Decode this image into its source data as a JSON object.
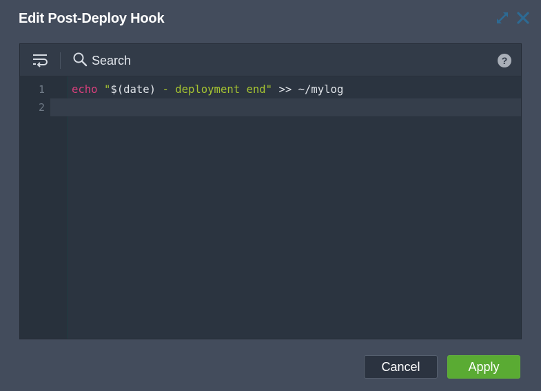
{
  "dialog": {
    "title": "Edit Post-Deploy Hook"
  },
  "header_icons": {
    "expand": "expand-arrows-icon",
    "close": "close-x-icon"
  },
  "toolbar": {
    "wrap_icon": "word-wrap-icon",
    "search_icon": "magnifier-icon",
    "search_label": "Search",
    "help_label": "?"
  },
  "editor": {
    "line_numbers": [
      "1",
      "2"
    ],
    "lines": [
      {
        "tokens": [
          {
            "text": "echo",
            "kind": "keyword"
          },
          {
            "text": " ",
            "kind": "plain"
          },
          {
            "text": "\"",
            "kind": "string"
          },
          {
            "text": "$(date)",
            "kind": "plain"
          },
          {
            "text": " - deployment end",
            "kind": "string"
          },
          {
            "text": "\"",
            "kind": "string"
          },
          {
            "text": " >> ~/mylog",
            "kind": "plain"
          }
        ]
      },
      {
        "tokens": []
      }
    ],
    "colors": {
      "keyword": "#d9407c",
      "string": "#a6c431",
      "plain": "#dfe3e8"
    }
  },
  "buttons": {
    "cancel_label": "Cancel",
    "apply_label": "Apply"
  },
  "colors": {
    "dialog_bg": "#434c5c",
    "editor_bg": "#2b3440",
    "apply_green": "#5aab33"
  }
}
